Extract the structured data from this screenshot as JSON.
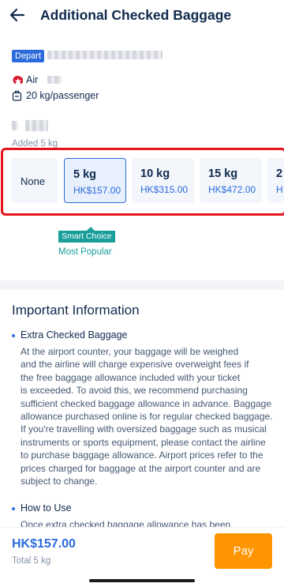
{
  "header": {
    "title": "Additional Checked Baggage",
    "back_icon": "arrow-left-icon"
  },
  "flight": {
    "depart_tag": "Depart",
    "airline_name": "Air",
    "allowance": "20 kg/passenger"
  },
  "passenger": {
    "added_text": "Added 5 kg"
  },
  "options": [
    {
      "weight": "None",
      "price": ""
    },
    {
      "weight": "5 kg",
      "price": "HK$157.00",
      "selected": true
    },
    {
      "weight": "10 kg",
      "price": "HK$315.00"
    },
    {
      "weight": "15 kg",
      "price": "HK$472.00"
    },
    {
      "weight": "2",
      "price": "H"
    }
  ],
  "badge": {
    "smart_choice": "Smart Choice",
    "most_popular": "Most Popular"
  },
  "info": {
    "title": "Important Information",
    "sections": [
      {
        "heading": "Extra Checked Baggage",
        "lines": [
          "At the airport counter, your baggage will be weighed",
          "and the airline will charge expensive overweight fees if",
          "the free baggage allowance included with your ticket",
          "is exceeded. To avoid this, we recommend purchasing",
          "sufficient checked baggage allowance in advance. Baggage",
          "allowance purchased online is for regular checked baggage.",
          "If you're travelling with oversized baggage such as musical",
          "instruments or sports equipment, please contact the airline",
          "to purchase baggage allowance. Airport prices refer to the",
          "prices charged for baggage at the airport counter and are",
          "subject to change."
        ]
      },
      {
        "heading": "How to Use",
        "lines": [
          "Once extra checked baggage allowance has been purchased"
        ]
      }
    ]
  },
  "footer": {
    "total_price": "HK$157.00",
    "total_label": "Total 5 kg",
    "pay_label": "Pay"
  },
  "colors": {
    "primary": "#2c6bdc",
    "accent": "#ff9500",
    "teal": "#1a9e9b",
    "highlight": "#e8141c"
  }
}
